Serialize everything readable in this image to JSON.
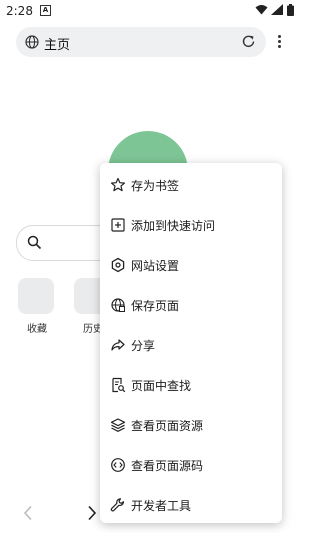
{
  "status_bar": {
    "time": "2:28",
    "notification": "A"
  },
  "address_bar": {
    "url": "主页"
  },
  "shortcuts": [
    {
      "label": "收藏"
    },
    {
      "label": "历史"
    }
  ],
  "menu": {
    "items": [
      {
        "label": "存为书签",
        "icon": "star-icon"
      },
      {
        "label": "添加到快速访问",
        "icon": "add-box-icon"
      },
      {
        "label": "网站设置",
        "icon": "hexagon-settings-icon"
      },
      {
        "label": "保存页面",
        "icon": "globe-save-icon"
      },
      {
        "label": "分享",
        "icon": "share-icon"
      },
      {
        "label": "页面中查找",
        "icon": "find-in-page-icon"
      },
      {
        "label": "查看页面资源",
        "icon": "layers-icon"
      },
      {
        "label": "查看页面源码",
        "icon": "source-code-icon"
      },
      {
        "label": "开发者工具",
        "icon": "wrench-icon"
      }
    ]
  },
  "colors": {
    "logo": "#7dc595",
    "addressbar_bg": "#eef0f2"
  }
}
